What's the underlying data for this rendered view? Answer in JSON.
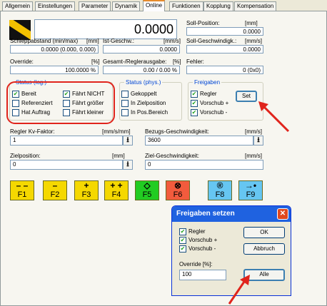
{
  "tabs": [
    "Allgemein",
    "Einstellungen",
    "Parameter",
    "Dynamik",
    "Online",
    "Funktionen",
    "Kopplung",
    "Kompensation"
  ],
  "active_tab": "Online",
  "position_value": "0.0000",
  "soll_position": {
    "label": "Soll-Position:",
    "unit": "[mm]",
    "value": "0.0000"
  },
  "schleppabstand": {
    "label": "Schleppabstand (min/max)",
    "unit": "[mm]",
    "value": "0.0000  (0.000, 0.000)"
  },
  "ist_geschw": {
    "label": "Ist-Geschw.:",
    "unit": "[mm/s]",
    "value": "0.0000"
  },
  "soll_geschw": {
    "label": "Soll-Geschwindigk.:",
    "unit": "[mm/s]",
    "value": "0.0000"
  },
  "override": {
    "label": "Override:",
    "unit": "[%]",
    "value": "100.0000 %"
  },
  "gesamt_regler": {
    "label": "Gesamt-/Reglerausgabe:",
    "unit": "[%]",
    "value": "0.00 / 0.00 %"
  },
  "fehler": {
    "label": "Fehler:",
    "value": "0 (0x0)"
  },
  "status_log": {
    "title": "Status (log.)",
    "items": [
      {
        "label": "Bereit",
        "checked": "✔"
      },
      {
        "label": "Fährt NICHT",
        "checked": "✔"
      },
      {
        "label": "Referenziert",
        "checked": ""
      },
      {
        "label": "Fährt größer",
        "checked": ""
      },
      {
        "label": "Hat Auftrag",
        "checked": ""
      },
      {
        "label": "Fährt kleiner",
        "checked": ""
      }
    ]
  },
  "status_phys": {
    "title": "Status (phys.)",
    "items": [
      {
        "label": "Gekoppelt",
        "checked": ""
      },
      {
        "label": "In Zielposition",
        "checked": ""
      },
      {
        "label": "In Pos.Bereich",
        "checked": ""
      }
    ]
  },
  "freigaben": {
    "title": "Freigaben",
    "items": [
      {
        "label": "Regler",
        "checked": "✔"
      },
      {
        "label": "Vorschub +",
        "checked": "✔"
      },
      {
        "label": "Vorschub -",
        "checked": "✔"
      }
    ],
    "set_label": "Set"
  },
  "regler_kv": {
    "label": "Regler Kv-Faktor:",
    "unit": "[mm/s/mm]",
    "value": "1"
  },
  "bezugs_geschw": {
    "label": "Bezugs-Geschwindigkeit:",
    "unit": "[mm/s]",
    "value": "3600"
  },
  "zielposition": {
    "label": "Zielposition:",
    "unit": "[mm]",
    "value": "0"
  },
  "ziel_geschw": {
    "label": "Ziel-Geschwindigkeit:",
    "unit": "[mm/s]",
    "value": "0"
  },
  "arrow_glyph": "⭳",
  "fkeys": [
    {
      "sym": "– –",
      "label": "F1",
      "color": "#f5d800"
    },
    {
      "sym": "–",
      "label": "F2",
      "color": "#f5d800"
    },
    {
      "sym": "+",
      "label": "F3",
      "color": "#f5d800"
    },
    {
      "sym": "+ +",
      "label": "F4",
      "color": "#f5d800"
    },
    {
      "sym": "◇",
      "label": "F5",
      "color": "#22cc22"
    },
    {
      "sym": "⊗",
      "label": "F6",
      "color": "#f25b3d"
    },
    {
      "sym": "®",
      "label": "F8",
      "color": "#66c6f2"
    },
    {
      "sym": "→•",
      "label": "F9",
      "color": "#66c6f2"
    }
  ],
  "dialog": {
    "title": "Freigaben setzen",
    "items": [
      {
        "label": "Regler",
        "checked": "✔"
      },
      {
        "label": "Vorschub +",
        "checked": "✔"
      },
      {
        "label": "Vorschub -",
        "checked": "✔"
      }
    ],
    "ok_label": "OK",
    "abbruch_label": "Abbruch",
    "override_label": "Override [%]:",
    "override_value": "100",
    "alle_label": "Alle",
    "close_glyph": "✕"
  },
  "colors": {
    "accent_blue": "#0046d5",
    "highlight_red": "#e0241c",
    "title_blue": "#1f62e0"
  }
}
